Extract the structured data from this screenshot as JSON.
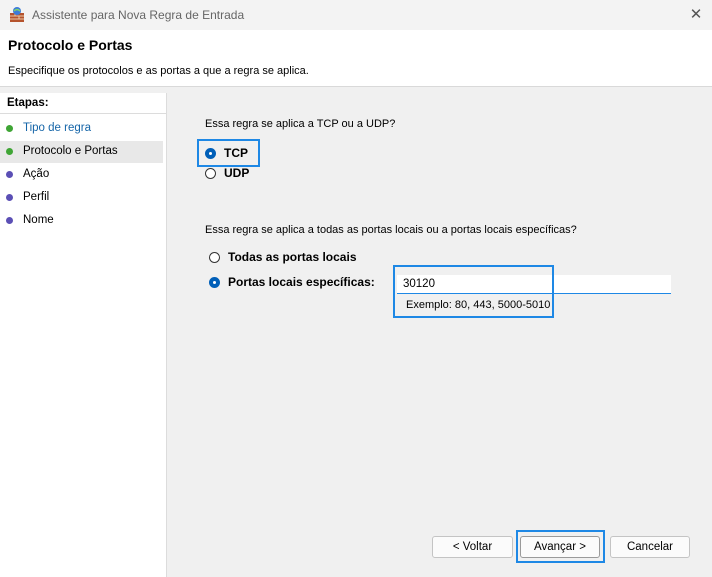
{
  "window": {
    "title": "Assistente para Nova Regra de Entrada",
    "close_glyph": "✕"
  },
  "header": {
    "title": "Protocolo e Portas",
    "subtitle": "Especifique os protocolos e as portas a que a regra se aplica."
  },
  "sidebar": {
    "title": "Etapas:",
    "steps": [
      {
        "label": "Tipo de regra",
        "state": "done"
      },
      {
        "label": "Protocolo e Portas",
        "state": "current"
      },
      {
        "label": "Ação",
        "state": "pending"
      },
      {
        "label": "Perfil",
        "state": "pending"
      },
      {
        "label": "Nome",
        "state": "pending"
      }
    ]
  },
  "protocol": {
    "question": "Essa regra se aplica a TCP ou a UDP?",
    "options": [
      {
        "label": "TCP",
        "selected": true
      },
      {
        "label": "UDP",
        "selected": false
      }
    ]
  },
  "ports": {
    "question": "Essa regra se aplica a todas as portas locais ou a portas locais específicas?",
    "options": [
      {
        "label": "Todas as portas locais",
        "selected": false
      },
      {
        "label": "Portas locais específicas:",
        "selected": true
      }
    ],
    "value": "30120",
    "hint": "Exemplo: 80, 443, 5000-5010"
  },
  "buttons": {
    "back": "< Voltar",
    "next": "Avançar >",
    "cancel": "Cancelar"
  },
  "colors": {
    "step_done": "#3fa535",
    "step_pending": "#5b4fb5",
    "accent": "#005fb8",
    "highlight": "#1e88e5"
  },
  "icons": {
    "app": "firewall-icon",
    "close": "close-icon"
  }
}
